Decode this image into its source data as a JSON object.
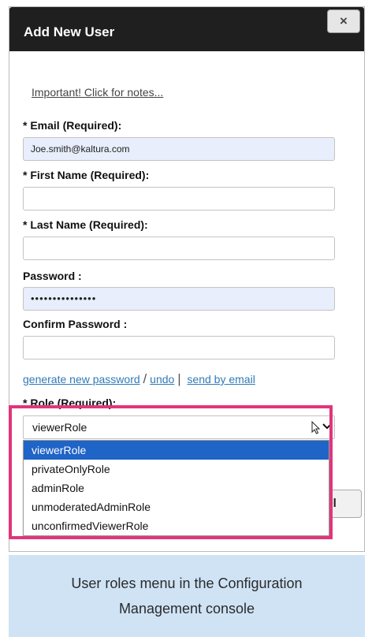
{
  "dialog": {
    "title": "Add New User",
    "close_label": "×",
    "notes_link": "Important! Click for notes...",
    "email": {
      "label": "* Email (Required):",
      "value": "Joe.smith@kaltura.com"
    },
    "first_name": {
      "label": "* First Name (Required):",
      "value": ""
    },
    "last_name": {
      "label": "* Last Name (Required):",
      "value": ""
    },
    "password": {
      "label": "Password :",
      "value": "•••••••••••••••"
    },
    "confirm_password": {
      "label": "Confirm Password :",
      "value": ""
    },
    "links": {
      "generate": "generate new password",
      "slash": "/",
      "undo": "undo",
      "bar": "|",
      "send": "send by email"
    },
    "role": {
      "label": "* Role (Required):",
      "selected": "viewerRole",
      "options": [
        "viewerRole",
        "privateOnlyRole",
        "adminRole",
        "unmoderatedAdminRole",
        "unconfirmedViewerRole"
      ]
    },
    "cancel_partial": "cel"
  },
  "highlight_color": "#e0367b",
  "caption": {
    "line1": "User roles menu in the Configuration",
    "line2": "Management console"
  },
  "icons": {
    "close": "close-icon",
    "chevron": "chevron-down-icon",
    "cursor": "mouse-pointer-icon"
  }
}
